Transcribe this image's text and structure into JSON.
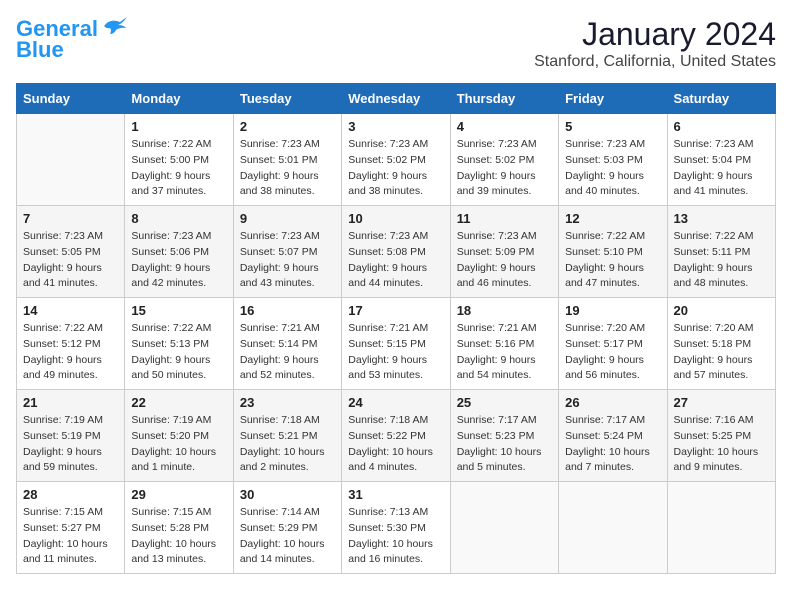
{
  "logo": {
    "line1": "General",
    "line2": "Blue"
  },
  "title": "January 2024",
  "location": "Stanford, California, United States",
  "days_header": [
    "Sunday",
    "Monday",
    "Tuesday",
    "Wednesday",
    "Thursday",
    "Friday",
    "Saturday"
  ],
  "weeks": [
    [
      {
        "num": "",
        "sunrise": "",
        "sunset": "",
        "daylight": ""
      },
      {
        "num": "1",
        "sunrise": "Sunrise: 7:22 AM",
        "sunset": "Sunset: 5:00 PM",
        "daylight": "Daylight: 9 hours and 37 minutes."
      },
      {
        "num": "2",
        "sunrise": "Sunrise: 7:23 AM",
        "sunset": "Sunset: 5:01 PM",
        "daylight": "Daylight: 9 hours and 38 minutes."
      },
      {
        "num": "3",
        "sunrise": "Sunrise: 7:23 AM",
        "sunset": "Sunset: 5:02 PM",
        "daylight": "Daylight: 9 hours and 38 minutes."
      },
      {
        "num": "4",
        "sunrise": "Sunrise: 7:23 AM",
        "sunset": "Sunset: 5:02 PM",
        "daylight": "Daylight: 9 hours and 39 minutes."
      },
      {
        "num": "5",
        "sunrise": "Sunrise: 7:23 AM",
        "sunset": "Sunset: 5:03 PM",
        "daylight": "Daylight: 9 hours and 40 minutes."
      },
      {
        "num": "6",
        "sunrise": "Sunrise: 7:23 AM",
        "sunset": "Sunset: 5:04 PM",
        "daylight": "Daylight: 9 hours and 41 minutes."
      }
    ],
    [
      {
        "num": "7",
        "sunrise": "Sunrise: 7:23 AM",
        "sunset": "Sunset: 5:05 PM",
        "daylight": "Daylight: 9 hours and 41 minutes."
      },
      {
        "num": "8",
        "sunrise": "Sunrise: 7:23 AM",
        "sunset": "Sunset: 5:06 PM",
        "daylight": "Daylight: 9 hours and 42 minutes."
      },
      {
        "num": "9",
        "sunrise": "Sunrise: 7:23 AM",
        "sunset": "Sunset: 5:07 PM",
        "daylight": "Daylight: 9 hours and 43 minutes."
      },
      {
        "num": "10",
        "sunrise": "Sunrise: 7:23 AM",
        "sunset": "Sunset: 5:08 PM",
        "daylight": "Daylight: 9 hours and 44 minutes."
      },
      {
        "num": "11",
        "sunrise": "Sunrise: 7:23 AM",
        "sunset": "Sunset: 5:09 PM",
        "daylight": "Daylight: 9 hours and 46 minutes."
      },
      {
        "num": "12",
        "sunrise": "Sunrise: 7:22 AM",
        "sunset": "Sunset: 5:10 PM",
        "daylight": "Daylight: 9 hours and 47 minutes."
      },
      {
        "num": "13",
        "sunrise": "Sunrise: 7:22 AM",
        "sunset": "Sunset: 5:11 PM",
        "daylight": "Daylight: 9 hours and 48 minutes."
      }
    ],
    [
      {
        "num": "14",
        "sunrise": "Sunrise: 7:22 AM",
        "sunset": "Sunset: 5:12 PM",
        "daylight": "Daylight: 9 hours and 49 minutes."
      },
      {
        "num": "15",
        "sunrise": "Sunrise: 7:22 AM",
        "sunset": "Sunset: 5:13 PM",
        "daylight": "Daylight: 9 hours and 50 minutes."
      },
      {
        "num": "16",
        "sunrise": "Sunrise: 7:21 AM",
        "sunset": "Sunset: 5:14 PM",
        "daylight": "Daylight: 9 hours and 52 minutes."
      },
      {
        "num": "17",
        "sunrise": "Sunrise: 7:21 AM",
        "sunset": "Sunset: 5:15 PM",
        "daylight": "Daylight: 9 hours and 53 minutes."
      },
      {
        "num": "18",
        "sunrise": "Sunrise: 7:21 AM",
        "sunset": "Sunset: 5:16 PM",
        "daylight": "Daylight: 9 hours and 54 minutes."
      },
      {
        "num": "19",
        "sunrise": "Sunrise: 7:20 AM",
        "sunset": "Sunset: 5:17 PM",
        "daylight": "Daylight: 9 hours and 56 minutes."
      },
      {
        "num": "20",
        "sunrise": "Sunrise: 7:20 AM",
        "sunset": "Sunset: 5:18 PM",
        "daylight": "Daylight: 9 hours and 57 minutes."
      }
    ],
    [
      {
        "num": "21",
        "sunrise": "Sunrise: 7:19 AM",
        "sunset": "Sunset: 5:19 PM",
        "daylight": "Daylight: 9 hours and 59 minutes."
      },
      {
        "num": "22",
        "sunrise": "Sunrise: 7:19 AM",
        "sunset": "Sunset: 5:20 PM",
        "daylight": "Daylight: 10 hours and 1 minute."
      },
      {
        "num": "23",
        "sunrise": "Sunrise: 7:18 AM",
        "sunset": "Sunset: 5:21 PM",
        "daylight": "Daylight: 10 hours and 2 minutes."
      },
      {
        "num": "24",
        "sunrise": "Sunrise: 7:18 AM",
        "sunset": "Sunset: 5:22 PM",
        "daylight": "Daylight: 10 hours and 4 minutes."
      },
      {
        "num": "25",
        "sunrise": "Sunrise: 7:17 AM",
        "sunset": "Sunset: 5:23 PM",
        "daylight": "Daylight: 10 hours and 5 minutes."
      },
      {
        "num": "26",
        "sunrise": "Sunrise: 7:17 AM",
        "sunset": "Sunset: 5:24 PM",
        "daylight": "Daylight: 10 hours and 7 minutes."
      },
      {
        "num": "27",
        "sunrise": "Sunrise: 7:16 AM",
        "sunset": "Sunset: 5:25 PM",
        "daylight": "Daylight: 10 hours and 9 minutes."
      }
    ],
    [
      {
        "num": "28",
        "sunrise": "Sunrise: 7:15 AM",
        "sunset": "Sunset: 5:27 PM",
        "daylight": "Daylight: 10 hours and 11 minutes."
      },
      {
        "num": "29",
        "sunrise": "Sunrise: 7:15 AM",
        "sunset": "Sunset: 5:28 PM",
        "daylight": "Daylight: 10 hours and 13 minutes."
      },
      {
        "num": "30",
        "sunrise": "Sunrise: 7:14 AM",
        "sunset": "Sunset: 5:29 PM",
        "daylight": "Daylight: 10 hours and 14 minutes."
      },
      {
        "num": "31",
        "sunrise": "Sunrise: 7:13 AM",
        "sunset": "Sunset: 5:30 PM",
        "daylight": "Daylight: 10 hours and 16 minutes."
      },
      {
        "num": "",
        "sunrise": "",
        "sunset": "",
        "daylight": ""
      },
      {
        "num": "",
        "sunrise": "",
        "sunset": "",
        "daylight": ""
      },
      {
        "num": "",
        "sunrise": "",
        "sunset": "",
        "daylight": ""
      }
    ]
  ]
}
